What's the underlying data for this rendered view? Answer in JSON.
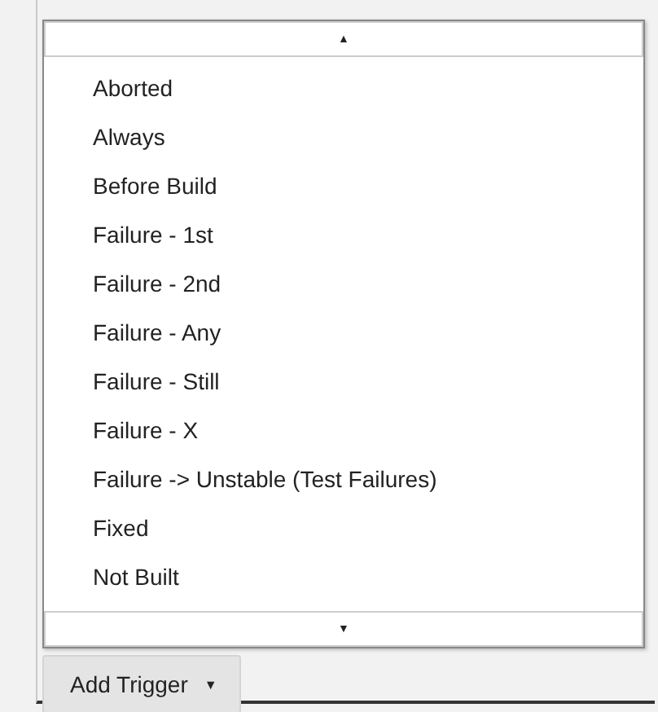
{
  "menu": {
    "scroll_up": "▲",
    "items": [
      {
        "label": "Aborted"
      },
      {
        "label": "Always"
      },
      {
        "label": "Before Build"
      },
      {
        "label": "Failure - 1st"
      },
      {
        "label": "Failure - 2nd"
      },
      {
        "label": "Failure - Any"
      },
      {
        "label": "Failure - Still"
      },
      {
        "label": "Failure - X"
      },
      {
        "label": "Failure -> Unstable (Test Failures)"
      },
      {
        "label": "Fixed"
      },
      {
        "label": "Not Built"
      }
    ],
    "scroll_down": "▼"
  },
  "add_button": {
    "label": "Add Trigger",
    "caret": "▼"
  }
}
